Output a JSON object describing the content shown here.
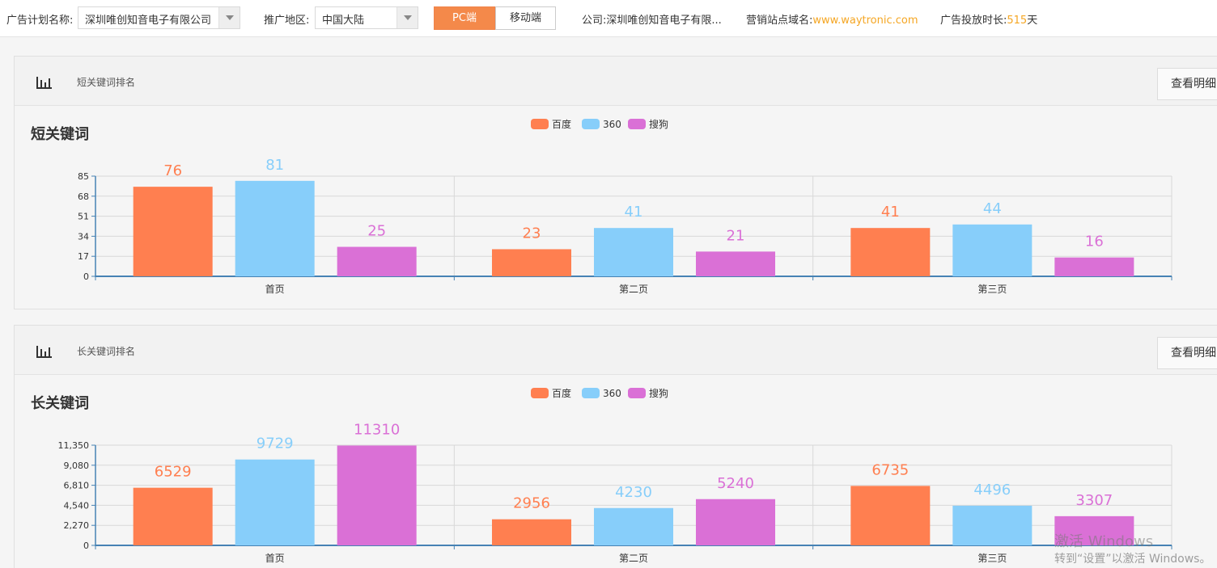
{
  "filters": {
    "plan_label": "广告计划名称:",
    "plan_value": "深圳唯创知音电子有限公司",
    "region_label": "推广地区:",
    "region_value": "中国大陆",
    "tab_pc": "PC端",
    "tab_mobile": "移动端",
    "company_label": "公司:",
    "company_value": "深圳唯创知音电子有限...",
    "domain_label": "营销站点域名:",
    "domain_value": "www.waytronic.com",
    "duration_label": "广告投放时长:",
    "duration_value": "515",
    "duration_unit": "天"
  },
  "panels": [
    {
      "header": "短关键词排名",
      "detail_label": "查看明细"
    },
    {
      "header": "长关键词排名",
      "detail_label": "查看明细"
    }
  ],
  "colors": {
    "baidu": "#ff7f50",
    "s360": "#87cefa",
    "sogou": "#da70d6"
  },
  "chart_data": [
    {
      "type": "bar",
      "title": "短关键词",
      "categories": [
        "首页",
        "第二页",
        "第三页"
      ],
      "series": [
        {
          "name": "百度",
          "values": [
            76,
            23,
            41
          ]
        },
        {
          "name": "360",
          "values": [
            81,
            41,
            44
          ]
        },
        {
          "name": "搜狗",
          "values": [
            25,
            21,
            16
          ]
        }
      ],
      "yticks": [
        0,
        17,
        34,
        51,
        68,
        85
      ],
      "ytick_labels": [
        "0",
        "17",
        "34",
        "51",
        "68",
        "85"
      ],
      "ylim": [
        0,
        85
      ],
      "legend": "top-center",
      "grid": true
    },
    {
      "type": "bar",
      "title": "长关键词",
      "categories": [
        "首页",
        "第二页",
        "第三页"
      ],
      "series": [
        {
          "name": "百度",
          "values": [
            6529,
            2956,
            6735
          ]
        },
        {
          "name": "360",
          "values": [
            9729,
            4230,
            4496
          ]
        },
        {
          "name": "搜狗",
          "values": [
            11310,
            5240,
            3307
          ]
        }
      ],
      "yticks": [
        0,
        2270,
        4540,
        6810,
        9080,
        11350
      ],
      "ytick_labels": [
        "0",
        "2,270",
        "4,540",
        "6,810",
        "9,080",
        "11,350"
      ],
      "ylim": [
        0,
        11350
      ],
      "legend": "top-center",
      "grid": true
    }
  ],
  "watermark": {
    "line1": "激活 Windows",
    "line2": "转到“设置”以激活 Windows。"
  }
}
